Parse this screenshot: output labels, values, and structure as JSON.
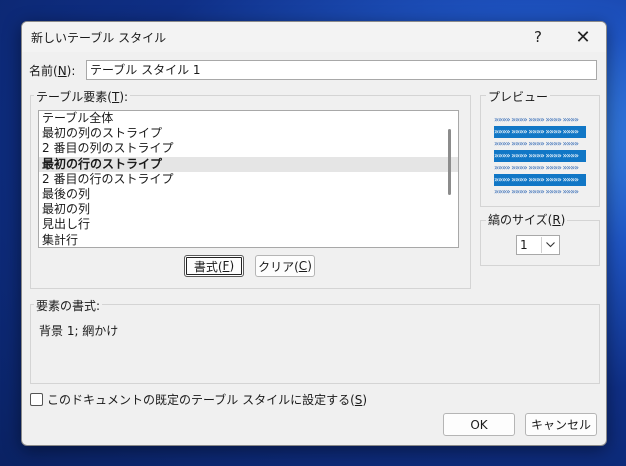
{
  "dialog": {
    "title": "新しいテーブル スタイル",
    "help_glyph": "?",
    "close_glyph": "✕"
  },
  "name": {
    "label_pre": "名前(",
    "label_key": "N",
    "label_post": "):",
    "value": "テーブル スタイル 1"
  },
  "elements": {
    "title_pre": "テーブル要素(",
    "title_key": "T",
    "title_post": "):",
    "items": [
      {
        "label": "テーブル全体",
        "selected": false
      },
      {
        "label": "最初の列のストライプ",
        "selected": false
      },
      {
        "label": "2 番目の列のストライプ",
        "selected": false
      },
      {
        "label": "最初の行のストライプ",
        "selected": true
      },
      {
        "label": "2 番目の行のストライプ",
        "selected": false
      },
      {
        "label": "最後の列",
        "selected": false
      },
      {
        "label": "最初の列",
        "selected": false
      },
      {
        "label": "見出し行",
        "selected": false
      },
      {
        "label": "集計行",
        "selected": false
      }
    ],
    "format_pre": "書式(",
    "format_key": "F",
    "format_post": ")",
    "clear_pre": "クリア(",
    "clear_key": "C",
    "clear_post": ")"
  },
  "preview": {
    "title": "プレビュー",
    "stripe_color": "#1177C6",
    "rows": [
      {
        "band": false,
        "text": "»»»» »»»» »»»» »»»» »»»»"
      },
      {
        "band": true,
        "text": "»»»» »»»» »»»» »»»» »»»»"
      },
      {
        "band": false,
        "text": "»»»» »»»» »»»» »»»» »»»»"
      },
      {
        "band": true,
        "text": "»»»» »»»» »»»» »»»» »»»»"
      },
      {
        "band": false,
        "text": "»»»» »»»» »»»» »»»» »»»»"
      },
      {
        "band": true,
        "text": "»»»» »»»» »»»» »»»» »»»»"
      },
      {
        "band": false,
        "text": "»»»» »»»» »»»» »»»» »»»»"
      }
    ]
  },
  "stripe_size": {
    "title_pre": "縞のサイズ(",
    "title_key": "R",
    "title_post": ")",
    "value": "1"
  },
  "element_format": {
    "title": "要素の書式:",
    "value": "背景 1; 網かけ"
  },
  "set_default": {
    "label_pre": "このドキュメントの既定のテーブル スタイルに設定する(",
    "label_key": "S",
    "label_post": ")",
    "checked": false
  },
  "buttons": {
    "ok": "OK",
    "cancel": "キャンセル"
  }
}
